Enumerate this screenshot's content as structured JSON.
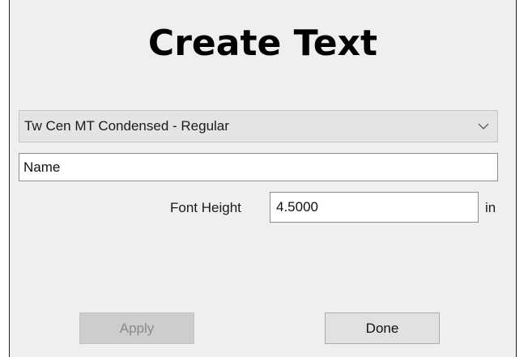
{
  "dialog": {
    "title": "Create Text"
  },
  "font_select": {
    "selected": "Tw Cen MT Condensed - Regular",
    "icon": "chevron-down-icon"
  },
  "name_field": {
    "value": "Name"
  },
  "font_height": {
    "label": "Font Height",
    "value": "4.5000",
    "unit": "in"
  },
  "buttons": {
    "apply_label": "Apply",
    "apply_enabled": false,
    "done_label": "Done"
  }
}
